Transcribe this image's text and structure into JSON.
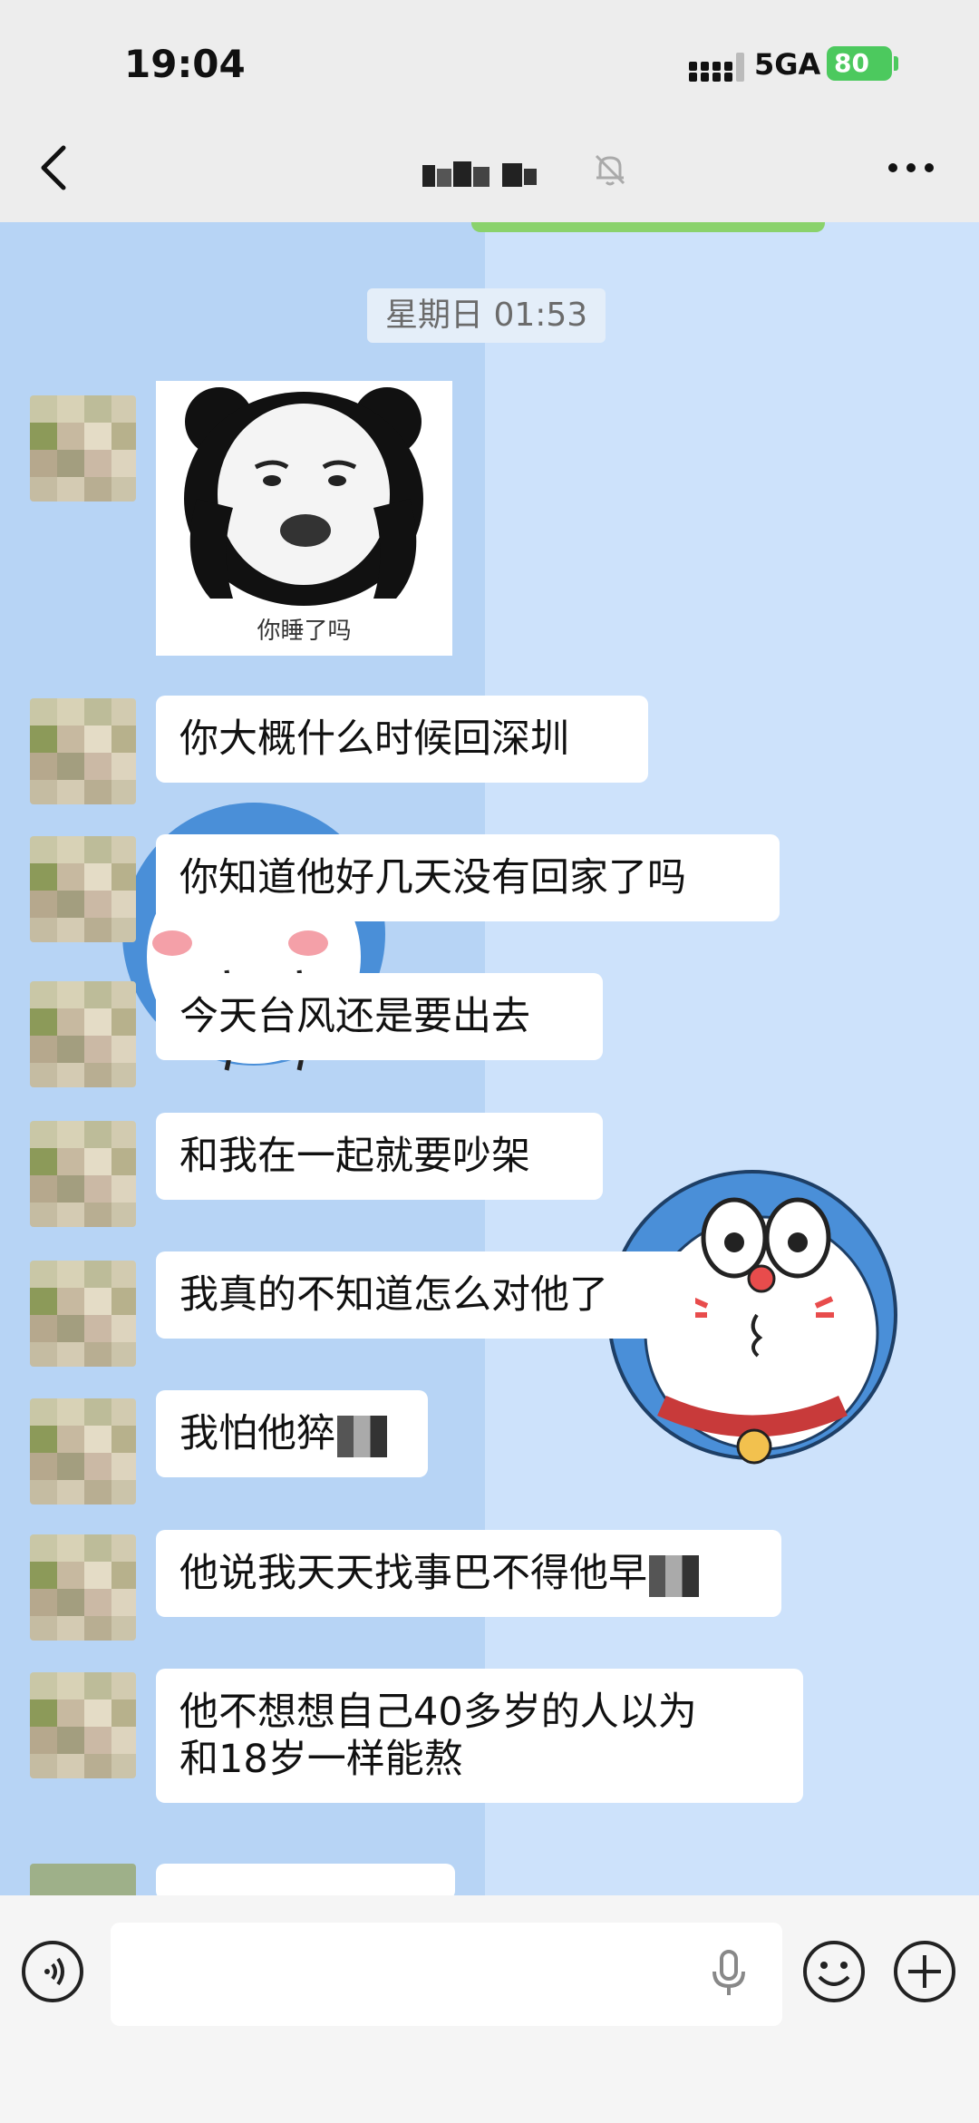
{
  "status_bar": {
    "time": "19:04",
    "network": "5GA",
    "battery": "80"
  },
  "nav": {
    "title_redacted": true,
    "back_icon": "chevron-left-icon",
    "mute_icon": "bell-off-icon",
    "more_icon": "more-horizontal-icon"
  },
  "chat": {
    "timestamp": "星期日 01:53",
    "sticker_caption": "你睡了吗",
    "messages": [
      {
        "text": "你大概什么时候回深圳"
      },
      {
        "text": "你知道他好几天没有回家了吗"
      },
      {
        "text": "今天台风还是要出去"
      },
      {
        "text": "和我在一起就要吵架"
      },
      {
        "text": "我真的不知道怎么对他了"
      },
      {
        "text": "我怕他猝"
      },
      {
        "text": "他说我天天找事巴不得他早"
      },
      {
        "line1": "他不想想自己40多岁的人以为",
        "line2": "和18岁一样能熬"
      }
    ]
  },
  "input_bar": {
    "voice_icon": "voice-icon",
    "mic_icon": "microphone-icon",
    "emoji_icon": "emoji-icon",
    "plus_icon": "plus-icon"
  },
  "colors": {
    "status_battery": "#4cc95e",
    "bubble": "#ffffff",
    "wallpaper_left": "#b7d4f5",
    "wallpaper_right": "#cde2fb"
  }
}
